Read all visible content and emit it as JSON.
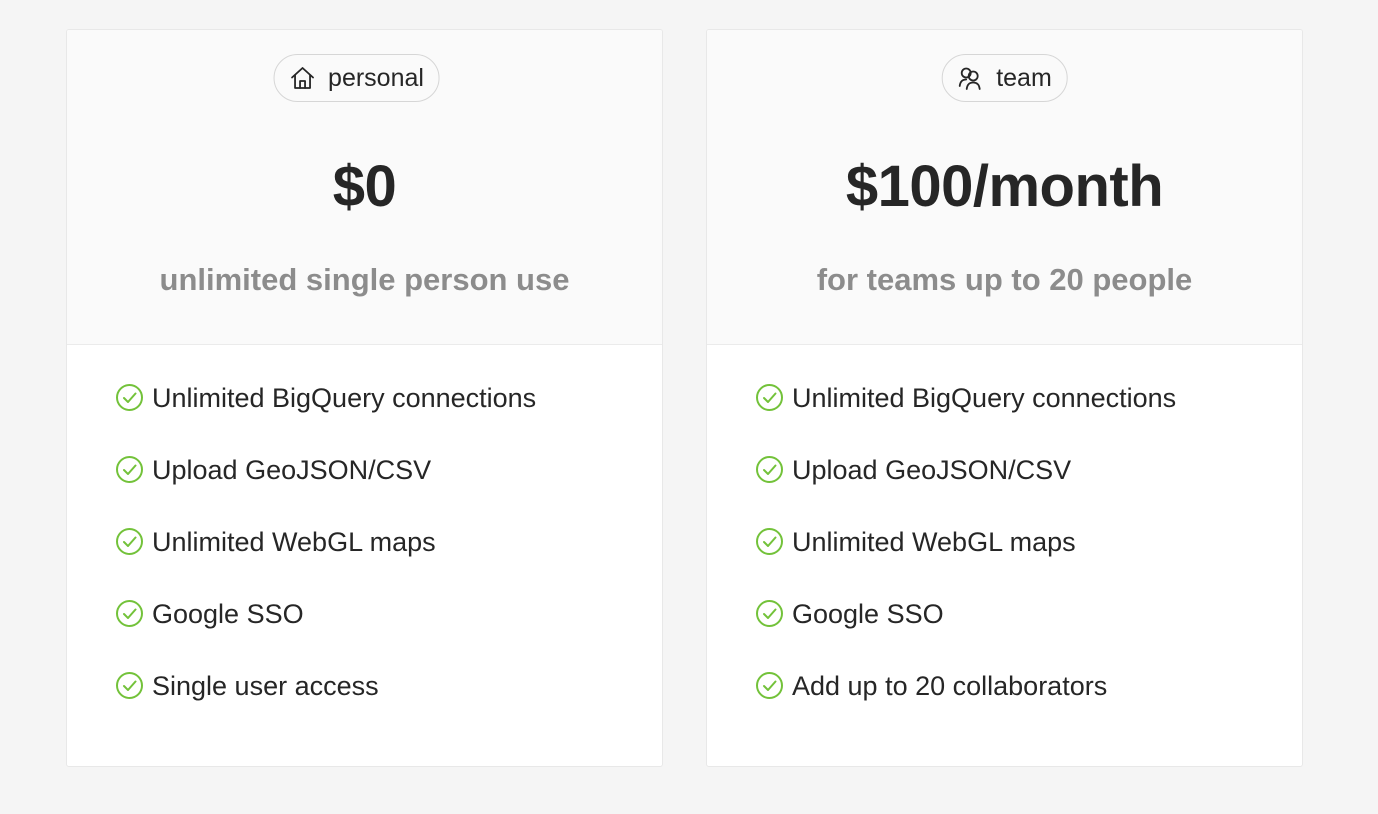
{
  "colors": {
    "background": "#f5f5f5",
    "card": "#ffffff",
    "card_header": "#fafafa",
    "check": "#73c23a",
    "subtitle": "#8c8c8c",
    "text": "#262626"
  },
  "plans": [
    {
      "tag_label": "personal",
      "tag_icon": "home-icon",
      "price": "$0",
      "subtitle": "unlimited single person use",
      "features": [
        "Unlimited BigQuery connections",
        "Upload GeoJSON/CSV",
        "Unlimited WebGL maps",
        "Google SSO",
        "Single user access"
      ]
    },
    {
      "tag_label": "team",
      "tag_icon": "users-icon",
      "price": "$100/month",
      "subtitle": "for teams up to 20 people",
      "features": [
        "Unlimited BigQuery connections",
        "Upload GeoJSON/CSV",
        "Unlimited WebGL maps",
        "Google SSO",
        "Add up to 20 collaborators"
      ]
    }
  ]
}
